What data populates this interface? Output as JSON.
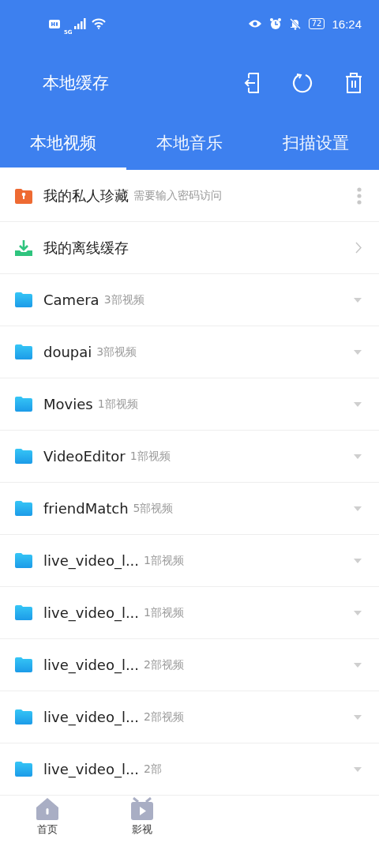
{
  "status_bar": {
    "network": "5G",
    "battery": "72",
    "time": "16:24"
  },
  "header": {
    "title": "本地缓存"
  },
  "tabs": [
    {
      "label": "本地视频",
      "selected": true
    },
    {
      "label": "本地音乐",
      "selected": false
    },
    {
      "label": "扫描设置",
      "selected": false
    }
  ],
  "items": [
    {
      "kind": "private",
      "name": "我的私人珍藏",
      "note": "需要输入密码访问"
    },
    {
      "kind": "offline",
      "name": "我的离线缓存"
    },
    {
      "kind": "folder",
      "name": "Camera",
      "note": "3部视频"
    },
    {
      "kind": "folder",
      "name": "doupai",
      "note": "3部视频"
    },
    {
      "kind": "folder",
      "name": "Movies",
      "note": "1部视频"
    },
    {
      "kind": "folder",
      "name": "VideoEditor",
      "note": "1部视频"
    },
    {
      "kind": "folder",
      "name": "friendMatch",
      "note": "5部视频"
    },
    {
      "kind": "folder",
      "name": "live_video_l...",
      "note": "1部视频"
    },
    {
      "kind": "folder",
      "name": "live_video_l...",
      "note": "1部视频"
    },
    {
      "kind": "folder",
      "name": "live_video_l...",
      "note": "2部视频"
    },
    {
      "kind": "folder",
      "name": "live_video_l...",
      "note": "2部视频"
    },
    {
      "kind": "folder",
      "name": "live_video_l...",
      "note": "2部"
    }
  ],
  "bottom_nav": [
    {
      "kind": "home",
      "label": "首页"
    },
    {
      "kind": "video",
      "label": "影视"
    }
  ]
}
